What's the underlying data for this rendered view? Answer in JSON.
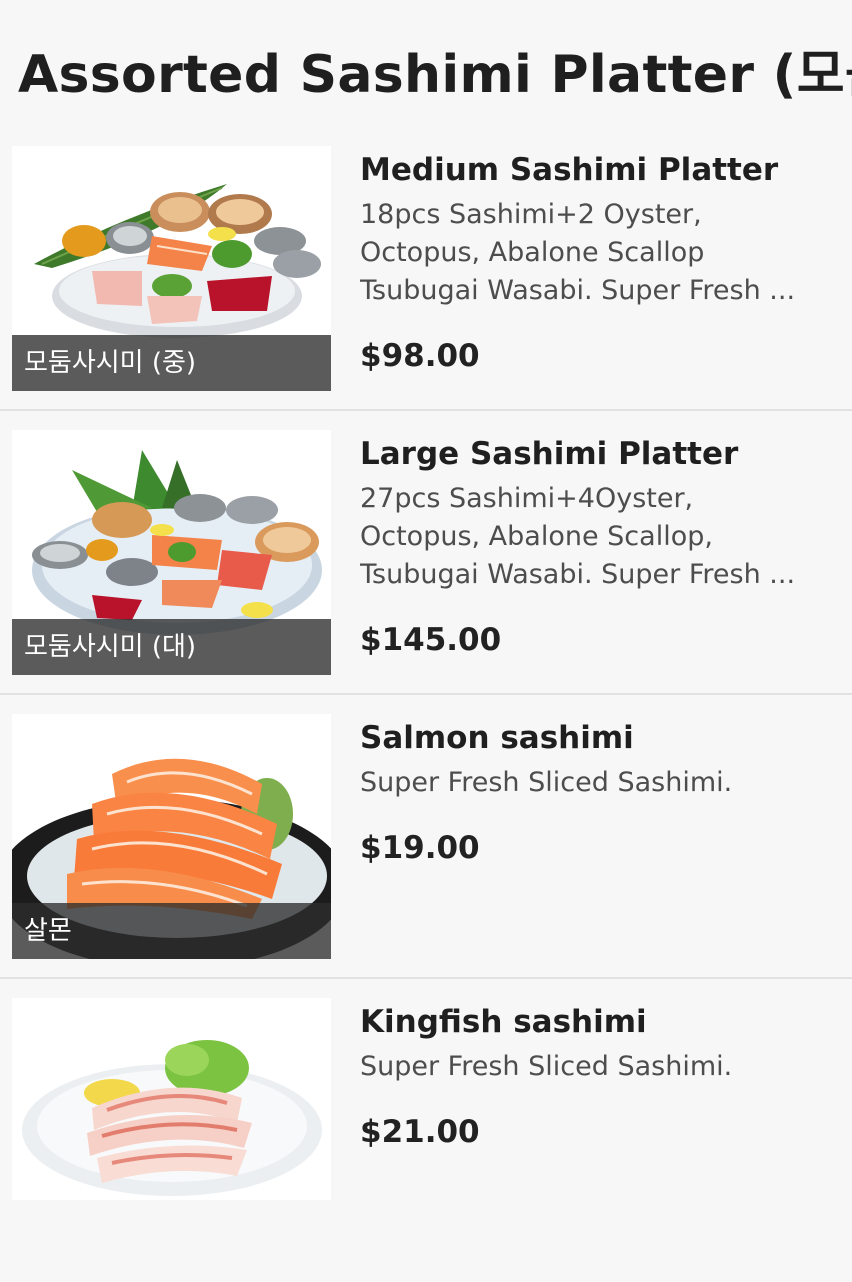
{
  "section": {
    "title": "Assorted Sashimi Platter (모둠"
  },
  "items": [
    {
      "name": "Medium Sashimi Platter",
      "description_lines": [
        "18pcs Sashimi+2 Oyster,",
        "Octopus, Abalone Scallop",
        "Tsubugai Wasabi. Super Fresh ..."
      ],
      "price": "$98.00",
      "image_label": "모둠사시미 (중)"
    },
    {
      "name": "Large Sashimi Platter",
      "description_lines": [
        "27pcs Sashimi+4Oyster,",
        "Octopus, Abalone Scallop,",
        "Tsubugai Wasabi. Super Fresh ..."
      ],
      "price": "$145.00",
      "image_label": "모둠사시미 (대)"
    },
    {
      "name": "Salmon sashimi",
      "description_lines": [
        "Super Fresh Sliced Sashimi."
      ],
      "price": "$19.00",
      "image_label": "살몬"
    },
    {
      "name": "Kingfish sashimi",
      "description_lines": [
        "Super Fresh Sliced Sashimi."
      ],
      "price": "$21.00",
      "image_label": ""
    }
  ],
  "colors": {
    "background": "#f7f7f7",
    "divider": "#e2e2e2",
    "label_overlay": "#2d2d2d",
    "text": "#1f1f1f"
  }
}
